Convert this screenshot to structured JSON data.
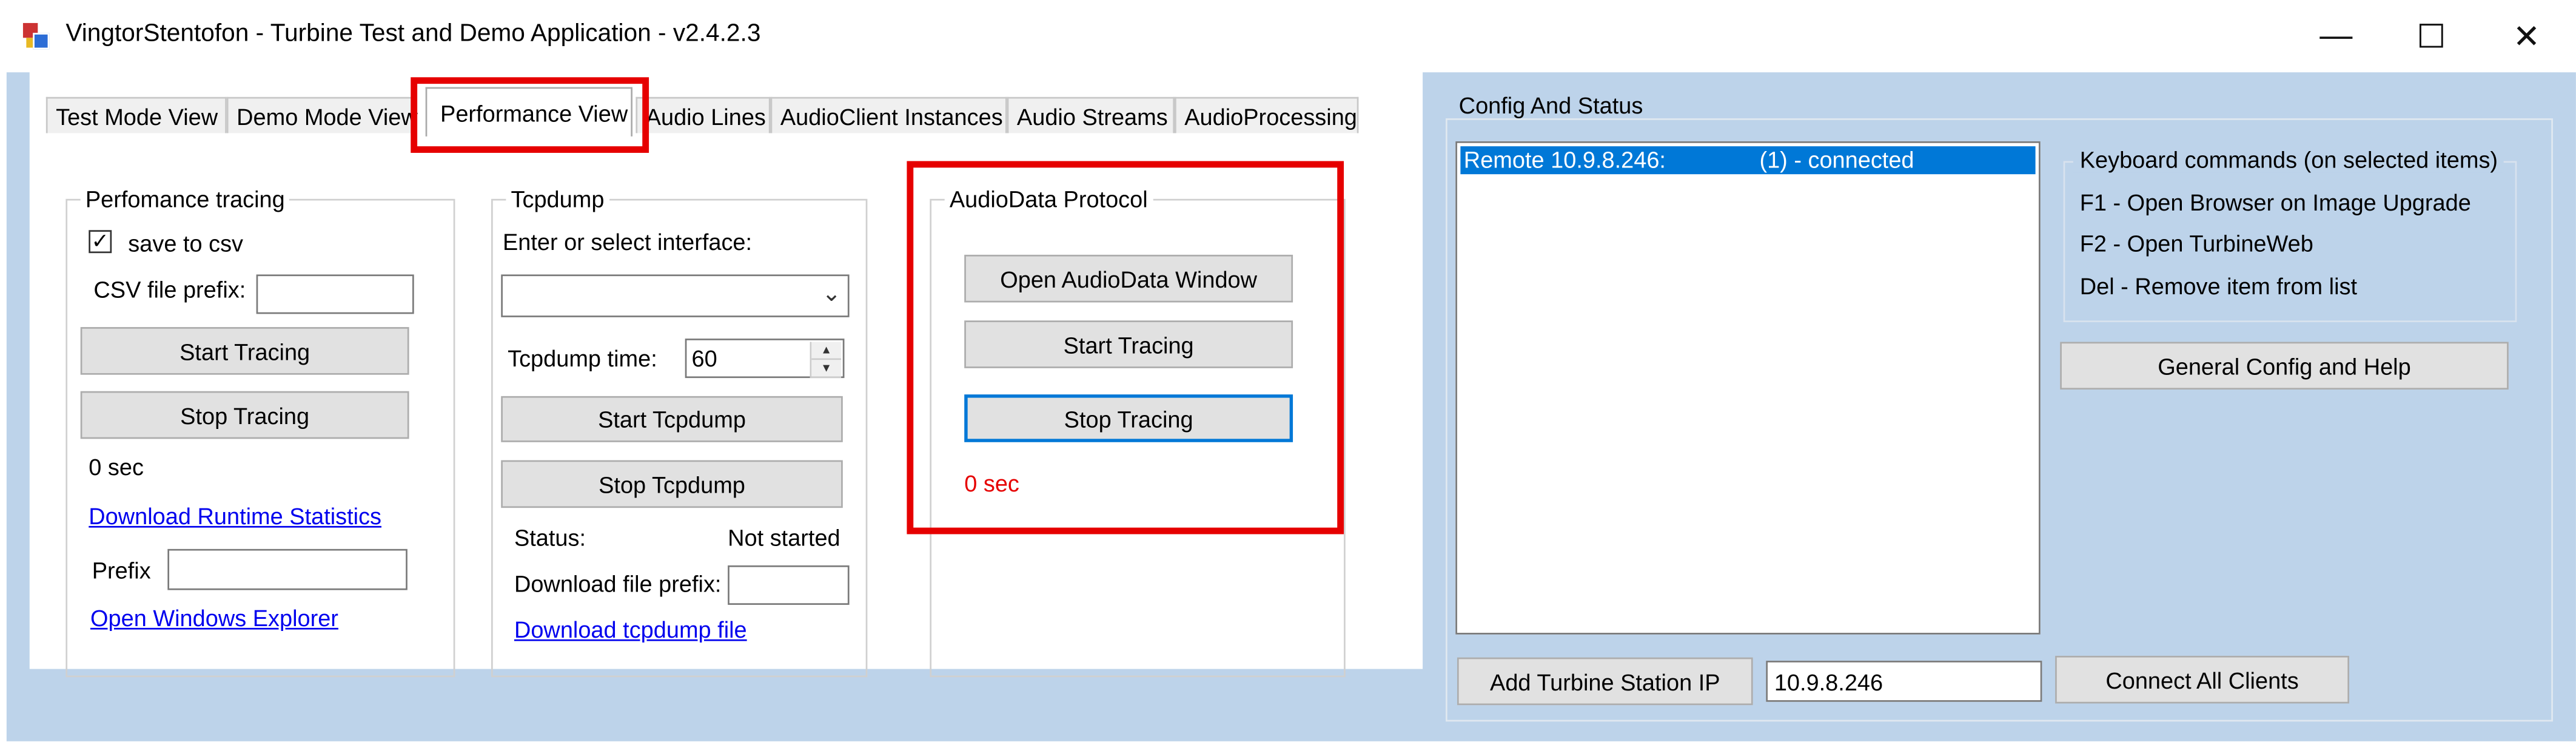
{
  "window": {
    "title": "VingtorStentofon - Turbine Test and Demo Application - v2.4.2.3",
    "minimize": "—",
    "maximize": "☐",
    "close": "✕"
  },
  "tabs": [
    {
      "label": "Test Mode View"
    },
    {
      "label": "Demo Mode View"
    },
    {
      "label": "Performance View"
    },
    {
      "label": "Audio Lines"
    },
    {
      "label": "AudioClient Instances"
    },
    {
      "label": "Audio Streams"
    },
    {
      "label": "AudioProcessing"
    }
  ],
  "perf": {
    "title": "Perfomance tracing",
    "save_csv": "save to csv",
    "csv_prefix_label": "CSV file prefix:",
    "csv_prefix_value": "",
    "start": "Start Tracing",
    "stop": "Stop Tracing",
    "elapsed": "0 sec",
    "download_stats": "Download Runtime Statistics",
    "prefix_label": "Prefix",
    "prefix_value": "",
    "open_explorer": "Open Windows Explorer"
  },
  "tcpdump": {
    "title": "Tcpdump",
    "iface_label": "Enter or select interface:",
    "iface_value": "",
    "time_label": "Tcpdump time:",
    "time_value": "60",
    "start": "Start Tcpdump",
    "stop": "Stop Tcpdump",
    "status_label": "Status:",
    "status_value": "Not started",
    "file_prefix_label": "Download file prefix:",
    "file_prefix_value": "",
    "download": "Download tcpdump file"
  },
  "audiodata": {
    "title": "AudioData Protocol",
    "open_window": "Open AudioData Window",
    "start": "Start Tracing",
    "stop": "Stop Tracing",
    "elapsed": "0 sec",
    "elapsed_color": "#e60000"
  },
  "config": {
    "title": "Config And Status",
    "list": [
      {
        "name": "Remote 10.9.8.246:",
        "status": "(1) - connected"
      }
    ],
    "keyboard_title": "Keyboard commands (on selected items)",
    "keyboard": [
      "F1 - Open Browser on Image Upgrade",
      "F2 - Open TurbineWeb",
      "Del - Remove item from list"
    ],
    "general_help": "General Config and Help",
    "add_station": "Add Turbine Station IP",
    "ip_value": "10.9.8.246",
    "connect_all": "Connect  All Clients"
  },
  "colors": {
    "highlight": "#e60000",
    "selection": "#0078d7",
    "background": "#bdd3ea"
  }
}
